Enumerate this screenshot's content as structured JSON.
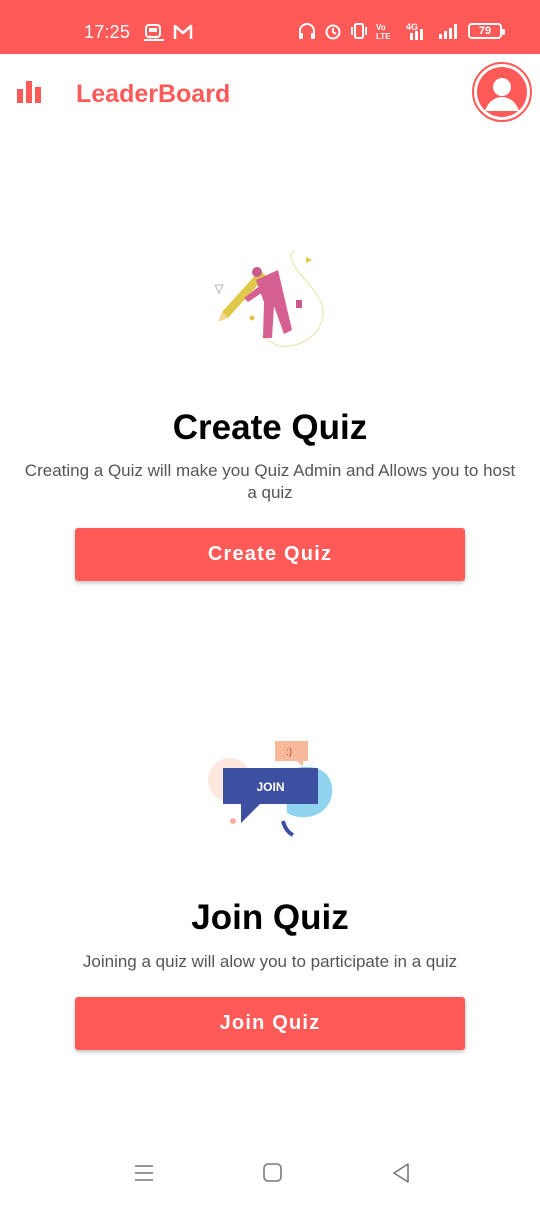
{
  "status_bar": {
    "time": "17:25",
    "battery": "79",
    "network": "4G",
    "left_icons": [
      "train-icon",
      "gmail-icon"
    ],
    "right_icons": [
      "headphones-icon",
      "alarm-icon",
      "vibrate-icon",
      "volte-icon",
      "data-icon",
      "signal-icon",
      "battery-icon"
    ]
  },
  "app_bar": {
    "title": "LeaderBoard",
    "left_icon": "bar-chart-icon",
    "right_icon": "profile-icon"
  },
  "create_section": {
    "heading": "Create Quiz",
    "description": "Creating a Quiz will make you Quiz Admin and Allows you to host a quiz",
    "button_label": "Create Quiz",
    "illustration": "person-with-pencil-illustration"
  },
  "join_section": {
    "heading": "Join Quiz",
    "description": "Joining a quiz will alow you to participate in a quiz",
    "button_label": "Join Quiz",
    "illustration_text": "JOIN",
    "illustration": "join-speech-bubble-illustration"
  },
  "nav_bar": {
    "icons": [
      "menu-icon",
      "home-icon",
      "back-icon"
    ]
  },
  "colors": {
    "accent": "#ff5a57",
    "text_primary": "#000000",
    "text_secondary": "#555555",
    "join_bubble": "#3d4fa0"
  }
}
